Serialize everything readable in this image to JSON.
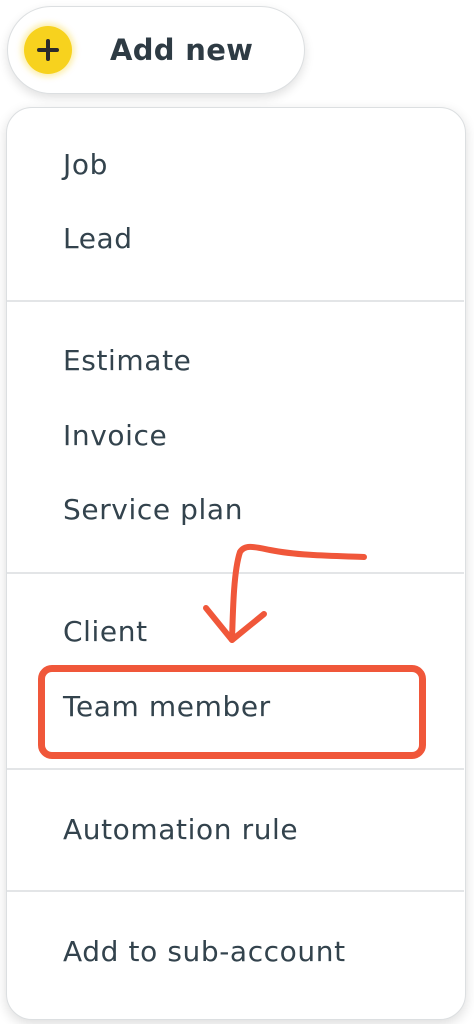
{
  "add_button": {
    "label": "Add new",
    "icon": "plus-icon",
    "accent_color": "#f7d21e"
  },
  "menu": {
    "groups": [
      {
        "items": [
          "Job",
          "Lead"
        ]
      },
      {
        "items": [
          "Estimate",
          "Invoice",
          "Service plan"
        ]
      },
      {
        "items": [
          "Client",
          "Team member"
        ]
      },
      {
        "items": [
          "Automation rule"
        ]
      },
      {
        "items": [
          "Add to sub-account"
        ]
      }
    ]
  },
  "annotation": {
    "highlighted_item": "Team member",
    "color": "#f0573a"
  }
}
